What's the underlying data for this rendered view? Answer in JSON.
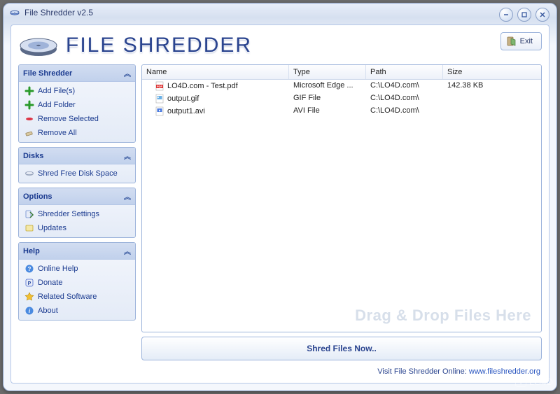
{
  "window": {
    "title": "File Shredder v2.5"
  },
  "logo": {
    "text": "FILE SHREDDER"
  },
  "exit_label": "Exit",
  "sidebar": {
    "panels": [
      {
        "title": "File Shredder",
        "items": [
          {
            "icon": "plus-green",
            "label": "Add File(s)"
          },
          {
            "icon": "plus-green",
            "label": "Add Folder"
          },
          {
            "icon": "minus-red",
            "label": "Remove Selected"
          },
          {
            "icon": "eraser",
            "label": "Remove All"
          }
        ]
      },
      {
        "title": "Disks",
        "items": [
          {
            "icon": "disk",
            "label": "Shred Free Disk Space"
          }
        ]
      },
      {
        "title": "Options",
        "items": [
          {
            "icon": "gear",
            "label": "Shredder Settings"
          },
          {
            "icon": "update",
            "label": "Updates"
          }
        ]
      },
      {
        "title": "Help",
        "items": [
          {
            "icon": "help",
            "label": "Online Help"
          },
          {
            "icon": "paypal",
            "label": "Donate"
          },
          {
            "icon": "star",
            "label": "Related Software"
          },
          {
            "icon": "about",
            "label": "About"
          }
        ]
      }
    ]
  },
  "filelist": {
    "columns": {
      "name": "Name",
      "type": "Type",
      "path": "Path",
      "size": "Size"
    },
    "rows": [
      {
        "icon": "pdf",
        "name": "LO4D.com - Test.pdf",
        "type": "Microsoft Edge ...",
        "path": "C:\\LO4D.com\\",
        "size": "142.38 KB"
      },
      {
        "icon": "gif",
        "name": "output.gif",
        "type": "GIF File",
        "path": "C:\\LO4D.com\\",
        "size": ""
      },
      {
        "icon": "avi",
        "name": "output1.avi",
        "type": "AVI File",
        "path": "C:\\LO4D.com\\",
        "size": ""
      }
    ],
    "watermark": "Drag & Drop Files Here"
  },
  "shred_button": "Shred Files Now..",
  "footer": {
    "text": "Visit File Shredder Online: ",
    "link": "www.fileshredder.org"
  },
  "site_watermark": "LO4D"
}
